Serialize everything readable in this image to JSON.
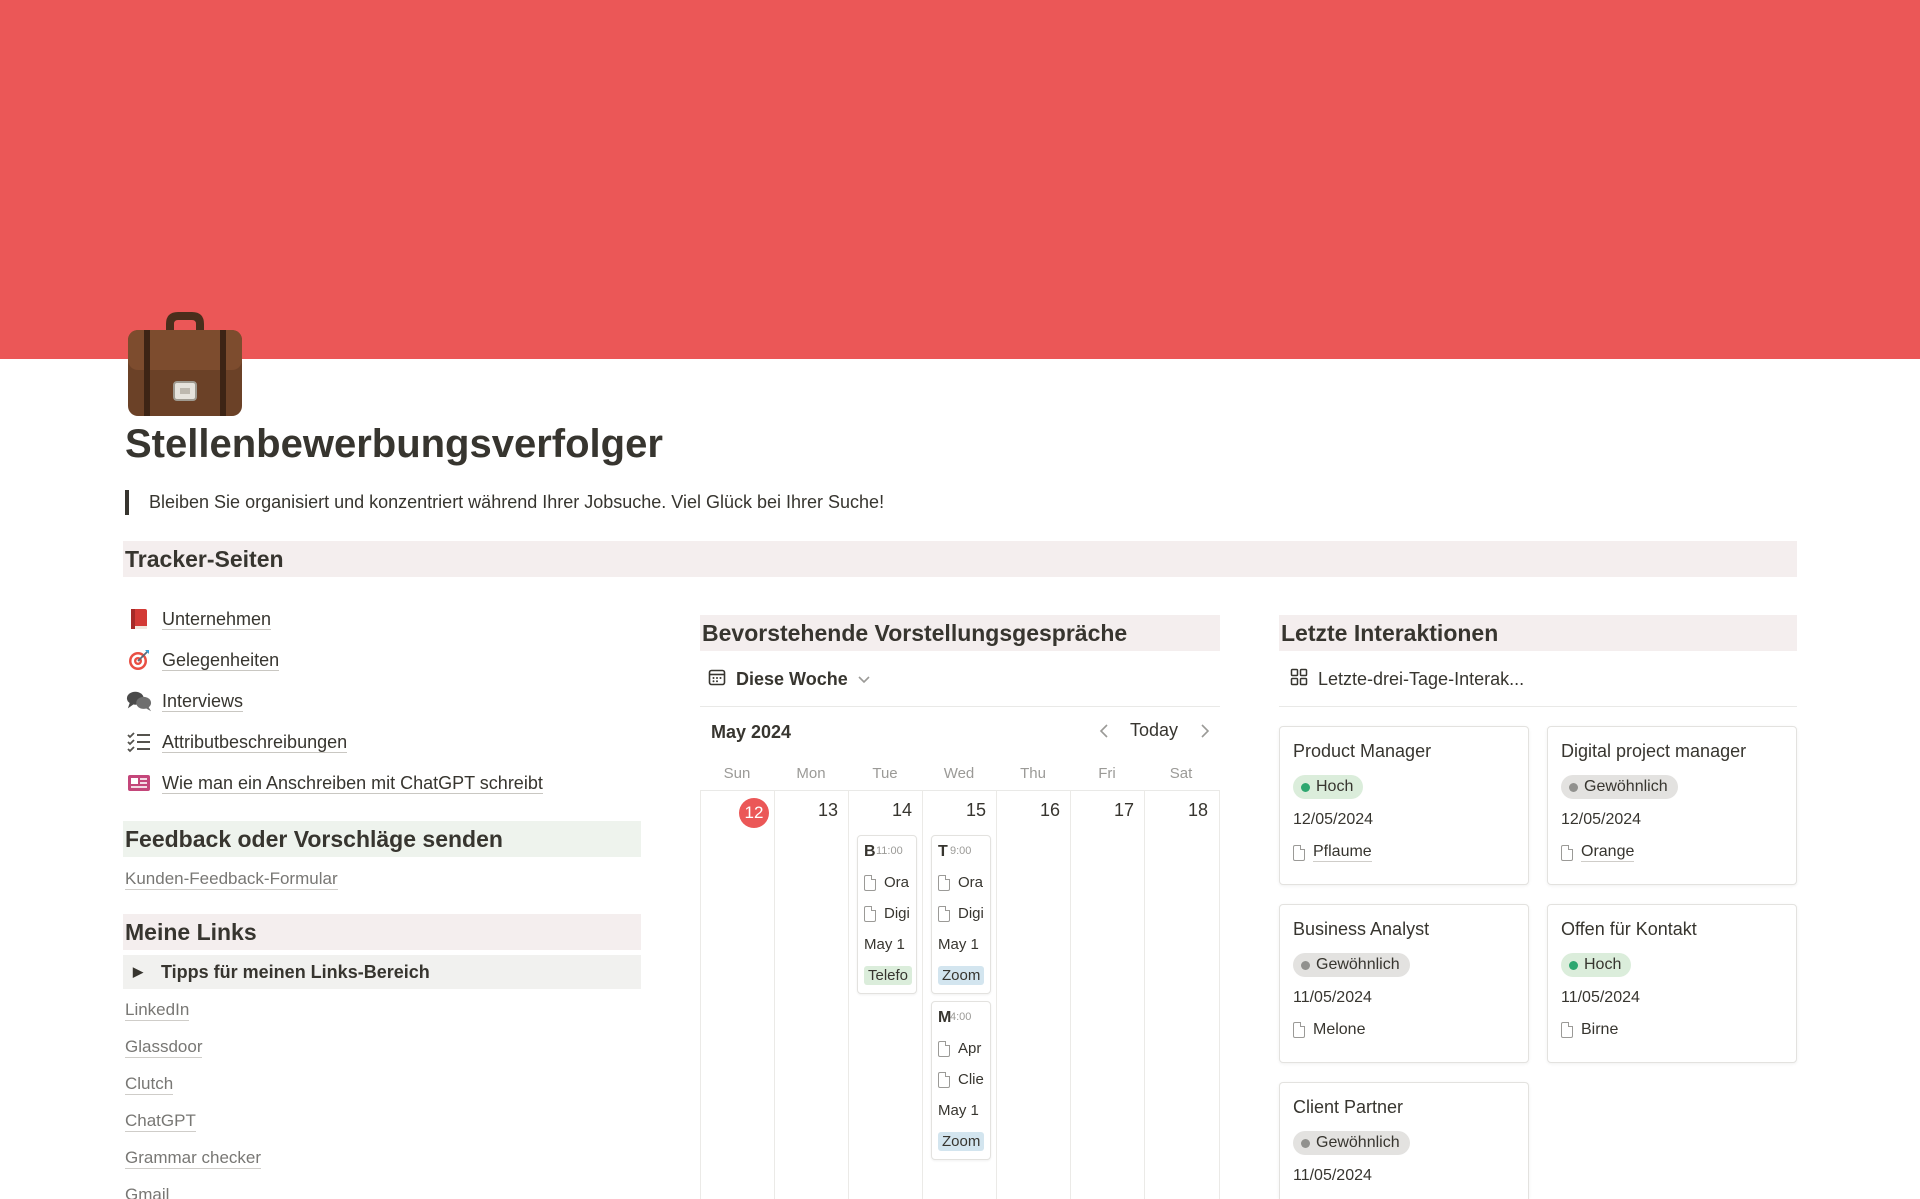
{
  "colors": {
    "cover": "#eb5757",
    "today": "#eb5757",
    "header_bg": "#f4eeee",
    "feedback_bg": "#eef3ed",
    "green_pill": "#dbeddb",
    "gray_pill": "#e3e2e0",
    "green_dot": "#2ea770",
    "gray_dot": "#91918e",
    "tag_green": "#dbeddb",
    "tag_blue": "#d3e5ef"
  },
  "page": {
    "icon": "briefcase-icon",
    "title": "Stellenbewerbungsverfolger",
    "quote": "Bleiben Sie organisiert und konzentriert während Ihrer Jobsuche. Viel Glück bei Ihrer Suche!"
  },
  "tracker": {
    "heading": "Tracker-Seiten",
    "items": [
      {
        "label": "Unternehmen",
        "icon": "red-book-icon"
      },
      {
        "label": "Gelegenheiten",
        "icon": "target-icon"
      },
      {
        "label": "Interviews",
        "icon": "speech-bubbles-icon"
      },
      {
        "label": "Attributbeschreibungen",
        "icon": "checklist-icon"
      },
      {
        "label": "Wie man ein Anschreiben mit ChatGPT schreibt",
        "icon": "id-card-icon"
      }
    ]
  },
  "feedback": {
    "heading": "Feedback oder Vorschläge senden",
    "link": "Kunden-Feedback-Formular"
  },
  "links": {
    "heading": "Meine Links",
    "toggle": "Tipps für meinen Links-Bereich",
    "items": [
      "LinkedIn",
      "Glassdoor",
      "Clutch",
      "ChatGPT",
      "Grammar checker",
      "Gmail"
    ]
  },
  "interviews": {
    "heading": "Bevorstehende Vorstellungsgespräche",
    "view_label": "Diese Woche",
    "month": "May 2024",
    "today_label": "Today",
    "weekdays": [
      "Sun",
      "Mon",
      "Tue",
      "Wed",
      "Thu",
      "Fri",
      "Sat"
    ],
    "days": [
      "12",
      "13",
      "14",
      "15",
      "16",
      "17",
      "18"
    ],
    "events": [
      {
        "title": "B",
        "time": "11:00",
        "company": "Ora",
        "role": "Digi",
        "date": "May 1",
        "tag": "Telefo",
        "tag_color": "green"
      },
      {
        "title": "T",
        "time": "9:00",
        "company": "Ora",
        "role": "Digi",
        "date": "May 1",
        "tag": "Zoom",
        "tag_color": "blue"
      },
      {
        "title": "M",
        "time": "4:00",
        "company": "Apr",
        "role": "Clie",
        "date": "May 1",
        "tag": "Zoom",
        "tag_color": "blue"
      }
    ]
  },
  "interactions": {
    "heading": "Letzte Interaktionen",
    "view_label": "Letzte-drei-Tage-Interak...",
    "cards": [
      {
        "title": "Product Manager",
        "priority": "Hoch",
        "priority_color": "green",
        "date": "12/05/2024",
        "company": "Pflaume",
        "underline": true
      },
      {
        "title": "Digital project manager",
        "priority": "Gewöhnlich",
        "priority_color": "gray",
        "date": "12/05/2024",
        "company": "Orange",
        "underline": true
      },
      {
        "title": "Business Analyst",
        "priority": "Gewöhnlich",
        "priority_color": "gray",
        "date": "11/05/2024",
        "company": "Melone",
        "underline": false
      },
      {
        "title": "Offen für Kontakt",
        "priority": "Hoch",
        "priority_color": "green",
        "date": "11/05/2024",
        "company": "Birne",
        "underline": false
      },
      {
        "title": "Client Partner",
        "priority": "Gewöhnlich",
        "priority_color": "gray",
        "date": "11/05/2024",
        "company": "",
        "underline": false
      }
    ]
  }
}
